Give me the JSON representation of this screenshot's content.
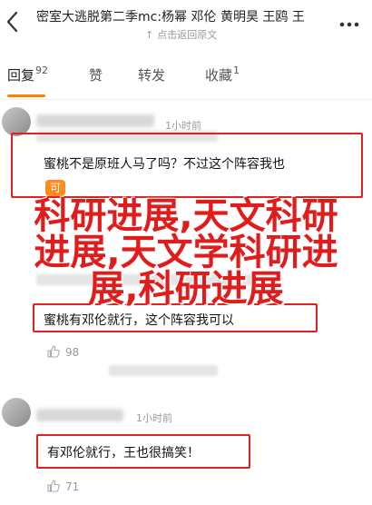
{
  "header": {
    "back_icon": "back-chevron-icon",
    "title": "密室大逃脱第二季mc:杨幂 邓伦 黄明昊 王鸥 王",
    "subtitle_prefix": "↑",
    "subtitle": "点击返回原文",
    "more_icon": "more-dots-icon"
  },
  "tabs": {
    "reply_label": "回复",
    "reply_count": "92",
    "like_label": "赞",
    "repost_label": "转发",
    "fav_label": "收藏",
    "fav_count": "1",
    "active_color": "#ff8200"
  },
  "comments": [
    {
      "time": "1小时前",
      "text": "蜜桃不是原班人马了吗？不过这个阵容我也",
      "text_tail": "可"
    },
    {
      "text": "蜜桃有邓伦就行，这个阵容我可以",
      "likes": "98"
    },
    {
      "time": "1小时前",
      "text": "有邓伦就行，王也很搞笑！",
      "likes": "71"
    }
  ],
  "overlay": {
    "line1": "科研进展,天文科研",
    "line2": "进展,天文学科研进",
    "line3": "展,科研进展",
    "color": "#e01c1c"
  }
}
